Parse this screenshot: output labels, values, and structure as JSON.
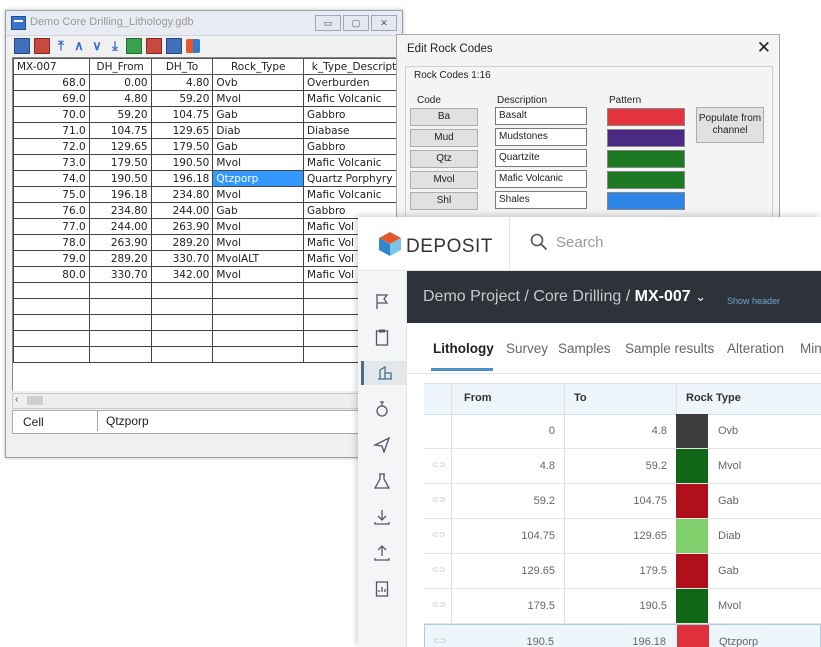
{
  "gdb_window": {
    "title": "Demo Core Drilling_Lithology.gdb",
    "columns": [
      "MX-007",
      "DH_From",
      "DH_To",
      "Rock_Type",
      "k_Type_Descript"
    ],
    "rows": [
      [
        "68.0",
        "0.00",
        "4.80",
        "Ovb",
        "Overburden"
      ],
      [
        "69.0",
        "4.80",
        "59.20",
        "Mvol",
        "Mafic Volcanic"
      ],
      [
        "70.0",
        "59.20",
        "104.75",
        "Gab",
        "Gabbro"
      ],
      [
        "71.0",
        "104.75",
        "129.65",
        "Diab",
        "Diabase"
      ],
      [
        "72.0",
        "129.65",
        "179.50",
        "Gab",
        "Gabbro"
      ],
      [
        "73.0",
        "179.50",
        "190.50",
        "Mvol",
        "Mafic Volcanic"
      ],
      [
        "74.0",
        "190.50",
        "196.18",
        "Qtzporp",
        "Quartz Porphyry"
      ],
      [
        "75.0",
        "196.18",
        "234.80",
        "Mvol",
        "Mafic Volcanic"
      ],
      [
        "76.0",
        "234.80",
        "244.00",
        "Gab",
        "Gabbro"
      ],
      [
        "77.0",
        "244.00",
        "263.90",
        "Mvol",
        "Mafic Vol"
      ],
      [
        "78.0",
        "263.90",
        "289.20",
        "Mvol",
        "Mafic Vol"
      ],
      [
        "79.0",
        "289.20",
        "330.70",
        "MvolALT",
        "Mafic Vol"
      ],
      [
        "80.0",
        "330.70",
        "342.00",
        "Mvol",
        "Mafic Vol"
      ]
    ],
    "selected_row": 6,
    "cell_label": "Cell",
    "cell_value": "Qtzporp"
  },
  "rock_codes_dialog": {
    "title": "Edit Rock Codes",
    "close": "✕",
    "group_label": "Rock Codes 1:16",
    "col_code": "Code",
    "col_description": "Description",
    "col_pattern": "Pattern",
    "populate_button": "Populate from channel",
    "codes": [
      {
        "code": "Ba",
        "description": "Basalt",
        "color": "#e4343f"
      },
      {
        "code": "Mud",
        "description": "Mudstones",
        "color": "#4b2a84"
      },
      {
        "code": "Qtz",
        "description": "Quartzite",
        "color": "#1d7a22"
      },
      {
        "code": "Mvol",
        "description": "Mafic Volcanic",
        "color": "#1d7a22"
      },
      {
        "code": "Shl",
        "description": "Shales",
        "color": "#2d86e6"
      }
    ]
  },
  "deposit_app": {
    "brand": "DEPOSIT",
    "search_placeholder": "Search",
    "breadcrumb_prefix": "Demo Project / Core Drilling / ",
    "breadcrumb_current": "MX-007",
    "show_header": "Show header",
    "tabs": [
      "Lithology",
      "Survey",
      "Samples",
      "Sample results",
      "Alteration",
      "Min"
    ],
    "table_headers": [
      "From",
      "To",
      "Rock Type"
    ],
    "rows": [
      {
        "from": "0",
        "to": "4.8",
        "rock": "Ovb",
        "color": "#3d3d3d"
      },
      {
        "from": "4.8",
        "to": "59.2",
        "rock": "Mvol",
        "color": "#0f6614"
      },
      {
        "from": "59.2",
        "to": "104.75",
        "rock": "Gab",
        "color": "#b0101c"
      },
      {
        "from": "104.75",
        "to": "129.65",
        "rock": "Diab",
        "color": "#7fcf6d"
      },
      {
        "from": "129.65",
        "to": "179.5",
        "rock": "Gab",
        "color": "#b0101c"
      },
      {
        "from": "179.5",
        "to": "190.5",
        "rock": "Mvol",
        "color": "#0f6614"
      },
      {
        "from": "190.5",
        "to": "196.18",
        "rock": "Qtzporp",
        "color": "#e0303c"
      }
    ],
    "highlighted_row": 6,
    "sidebar_icons": [
      "flag-icon",
      "clipboard-icon",
      "drillhole-icon",
      "flask-icon",
      "send-icon",
      "lab-icon",
      "download-icon",
      "upload-icon",
      "report-icon"
    ]
  }
}
